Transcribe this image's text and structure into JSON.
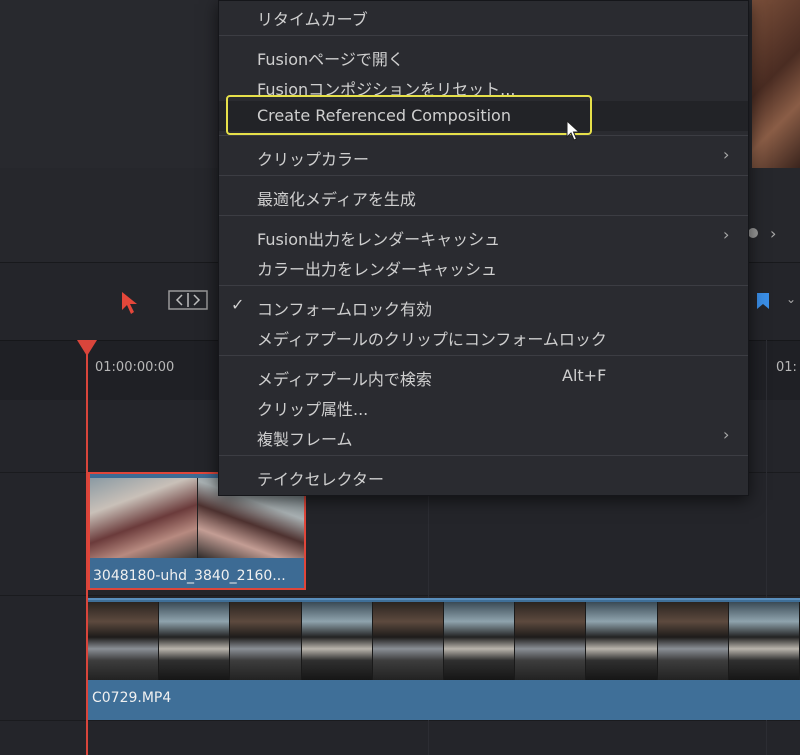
{
  "timeline": {
    "timecode_start": "01:00:00:00",
    "timecode_right": "01:",
    "video_clip_name": "3048180-uhd_3840_2160...",
    "audio_clip_name": "C0729.MP4",
    "playhead_color": "#d9453b",
    "clip_color": "#3f6f98"
  },
  "context_menu": {
    "items": [
      {
        "label": "リタイムカーブ"
      },
      {
        "label": "Fusionページで開く"
      },
      {
        "label": "Fusionコンポジションをリセット..."
      },
      {
        "label": "Create Referenced Composition",
        "highlighted": true
      },
      {
        "label": "クリップカラー",
        "submenu": true
      },
      {
        "label": "最適化メディアを生成"
      },
      {
        "label": "Fusion出力をレンダーキャッシュ",
        "submenu": true
      },
      {
        "label": "カラー出力をレンダーキャッシュ"
      },
      {
        "label": "コンフォームロック有効",
        "checked": true
      },
      {
        "label": "メディアプールのクリップにコンフォームロック"
      },
      {
        "label": "メディアプール内で検索",
        "shortcut": "Alt+F"
      },
      {
        "label": "クリップ属性..."
      },
      {
        "label": "複製フレーム",
        "submenu": true
      },
      {
        "label": "テイクセレクター"
      }
    ],
    "submenu_glyph": "›",
    "check_glyph": "✓",
    "highlight_color": "#e6e04a"
  },
  "icons": {
    "select_tool": "arrow-pointer-icon",
    "trim_tool": "trim-edit-icon",
    "flag": "flag-icon",
    "chevron": "chevron-down-icon",
    "cursor": "mouse-cursor-icon"
  },
  "glyphs": {
    "more_chevron": "⌄",
    "viewer_next": "›"
  }
}
